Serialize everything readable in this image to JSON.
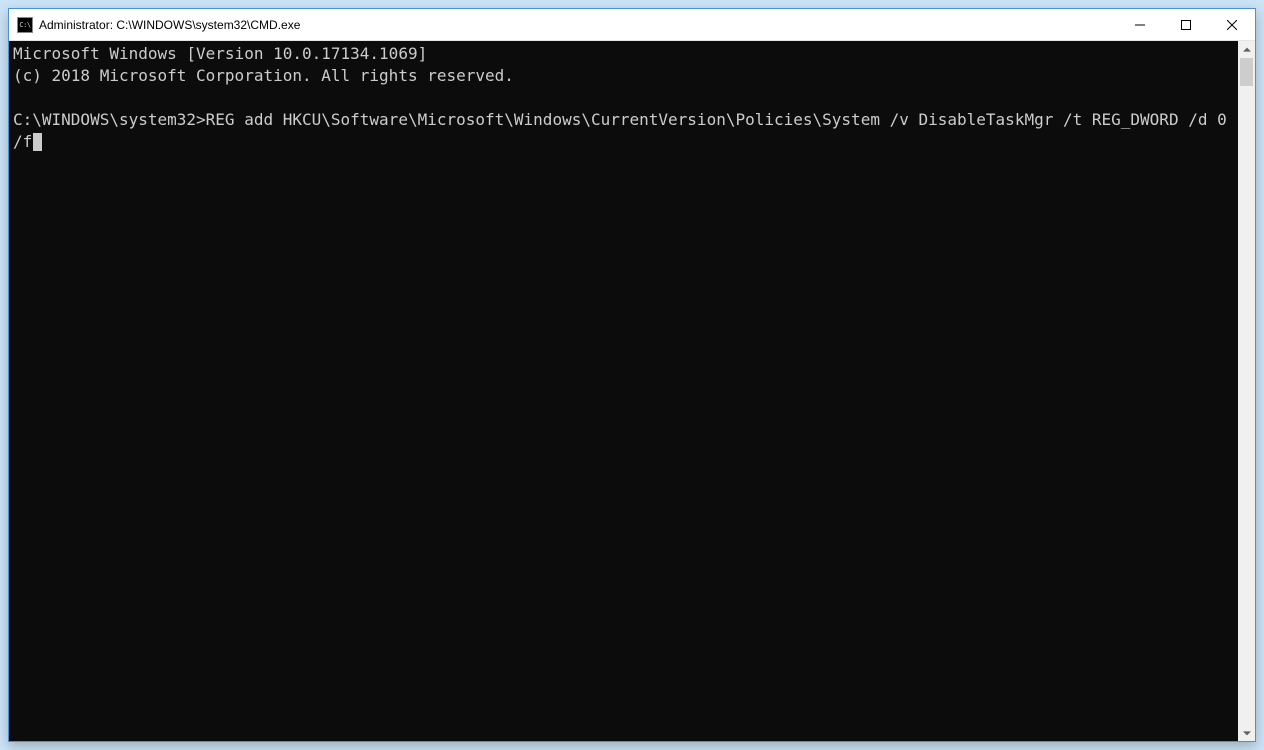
{
  "window": {
    "title": "Administrator: C:\\WINDOWS\\system32\\CMD.exe"
  },
  "terminal": {
    "header_line1": "Microsoft Windows [Version 10.0.17134.1069]",
    "header_line2": "(c) 2018 Microsoft Corporation. All rights reserved.",
    "prompt": "C:\\WINDOWS\\system32>",
    "command": "REG add HKCU\\Software\\Microsoft\\Windows\\CurrentVersion\\Policies\\System /v DisableTaskMgr /t REG_DWORD /d 0 /f"
  }
}
